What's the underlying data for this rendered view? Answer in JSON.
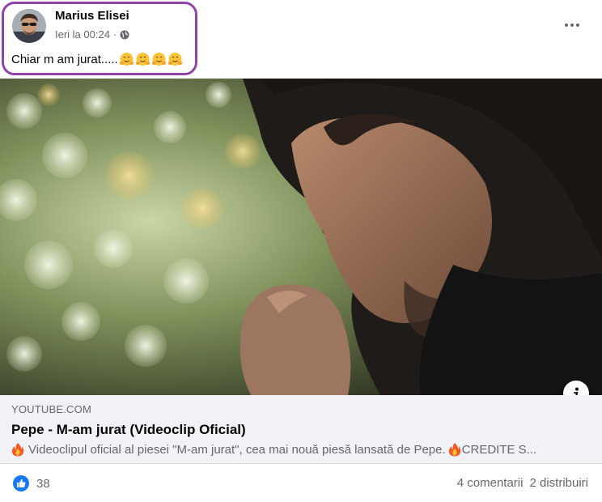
{
  "post": {
    "author_name": "Marius Elisei",
    "timestamp": "Ieri la 00:24",
    "meta_separator": "·",
    "privacy_icon": "globe-icon",
    "text": "Chiar m am jurat.....",
    "emojis": [
      "hugging-face-icon",
      "hugging-face-icon",
      "hugging-face-icon",
      "hugging-face-icon"
    ],
    "menu_icon": "more-options-icon"
  },
  "link_preview": {
    "domain": "YOUTUBE.COM",
    "title": "Pepe - M-am jurat (Videoclip Oficial)",
    "description": "Videoclipul oficial al piesei \"M-am jurat\", cea mai nouă piesă lansată de Pepe.",
    "description_tail": "CREDITE S...",
    "description_icon": "fire-icon",
    "info_icon": "info-icon"
  },
  "footer": {
    "reaction_icon": "like-icon",
    "reaction_count": "38",
    "comments": "4 comentarii",
    "shares": "2 distribuiri"
  },
  "colors": {
    "highlight_border": "#8e44a8",
    "secondary_text": "#65676b",
    "preview_bg": "#f0f2f5",
    "like_blue": "#1877f2"
  }
}
